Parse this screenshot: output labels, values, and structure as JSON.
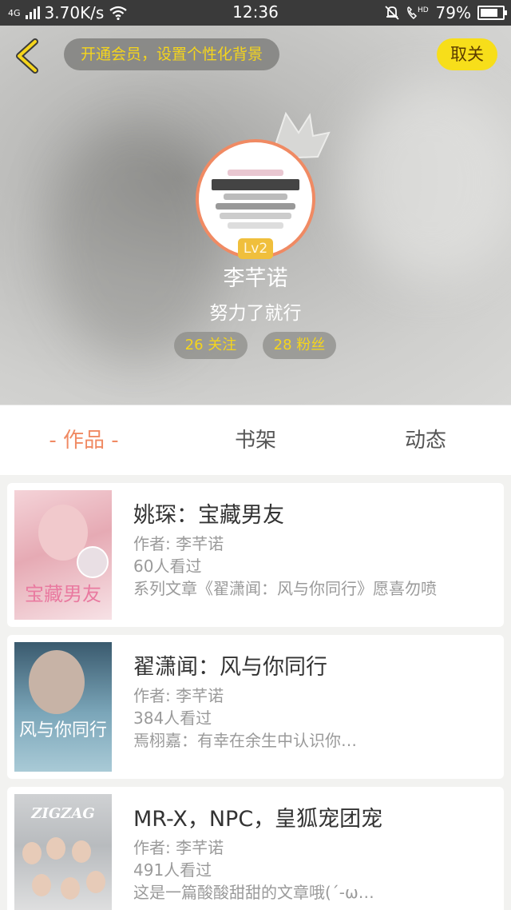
{
  "status_bar": {
    "network": "4G",
    "speed": "3.70K/s",
    "time": "12:36",
    "battery": "79%",
    "battery_level": 0.79
  },
  "header": {
    "vip_banner": "开通会员，设置个性化背景",
    "unfollow_label": "取关",
    "level": "Lv2",
    "username": "李芊诺",
    "signature": "努力了就行",
    "following": "26 关注",
    "fans": "28 粉丝"
  },
  "tabs": [
    "- 作品 -",
    "书架",
    "动态"
  ],
  "works": [
    {
      "title": "姚琛：宝藏男友",
      "author": "作者: 李芊诺",
      "views": "60人看过",
      "desc": "系列文章《翟潇闻：风与你同行》愿喜勿喷",
      "cover_text": "宝藏男友"
    },
    {
      "title": "翟潇闻：风与你同行",
      "author": "作者: 李芊诺",
      "views": "384人看过",
      "desc": "焉栩嘉：有幸在余生中认识你…",
      "cover_text": "风与你同行"
    },
    {
      "title": "MR-X，NPC，皇狐宠团宠",
      "author": "作者: 李芊诺",
      "views": "491人看过",
      "desc": "这是一篇酸酸甜甜的文章哦(´-ω…",
      "cover_text": "ZIGZAG"
    }
  ],
  "colors": {
    "accent": "#f08a63",
    "vip_text": "#f5d51c",
    "unfollow_bg": "#f7de1a"
  }
}
